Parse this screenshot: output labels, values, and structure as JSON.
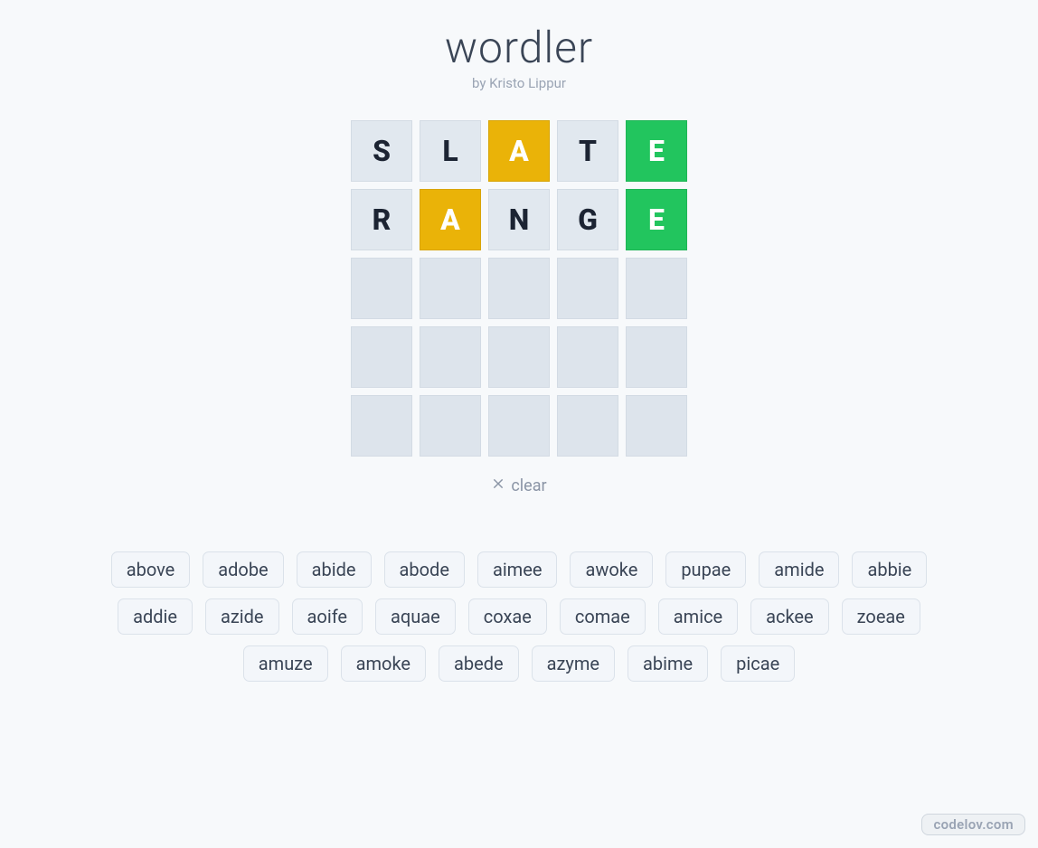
{
  "header": {
    "title": "wordler",
    "byline": "by Kristo Lippur"
  },
  "grid": {
    "rows": [
      [
        {
          "letter": "S",
          "state": "absent"
        },
        {
          "letter": "L",
          "state": "absent"
        },
        {
          "letter": "A",
          "state": "present"
        },
        {
          "letter": "T",
          "state": "absent"
        },
        {
          "letter": "E",
          "state": "correct"
        }
      ],
      [
        {
          "letter": "R",
          "state": "absent"
        },
        {
          "letter": "A",
          "state": "present"
        },
        {
          "letter": "N",
          "state": "absent"
        },
        {
          "letter": "G",
          "state": "absent"
        },
        {
          "letter": "E",
          "state": "correct"
        }
      ],
      [
        {
          "letter": "",
          "state": "empty"
        },
        {
          "letter": "",
          "state": "empty"
        },
        {
          "letter": "",
          "state": "empty"
        },
        {
          "letter": "",
          "state": "empty"
        },
        {
          "letter": "",
          "state": "empty"
        }
      ],
      [
        {
          "letter": "",
          "state": "empty"
        },
        {
          "letter": "",
          "state": "empty"
        },
        {
          "letter": "",
          "state": "empty"
        },
        {
          "letter": "",
          "state": "empty"
        },
        {
          "letter": "",
          "state": "empty"
        }
      ],
      [
        {
          "letter": "",
          "state": "empty"
        },
        {
          "letter": "",
          "state": "empty"
        },
        {
          "letter": "",
          "state": "empty"
        },
        {
          "letter": "",
          "state": "empty"
        },
        {
          "letter": "",
          "state": "empty"
        }
      ]
    ]
  },
  "actions": {
    "clear_label": "clear"
  },
  "suggestions": [
    "above",
    "adobe",
    "abide",
    "abode",
    "aimee",
    "awoke",
    "pupae",
    "amide",
    "abbie",
    "addie",
    "azide",
    "aoife",
    "aquae",
    "coxae",
    "comae",
    "amice",
    "ackee",
    "zoeae",
    "amuze",
    "amoke",
    "abede",
    "azyme",
    "abime",
    "picae"
  ],
  "watermark": "codelov.com",
  "colors": {
    "absent_bg": "#e1e8ef",
    "present_bg": "#eab308",
    "correct_bg": "#22c55e"
  }
}
